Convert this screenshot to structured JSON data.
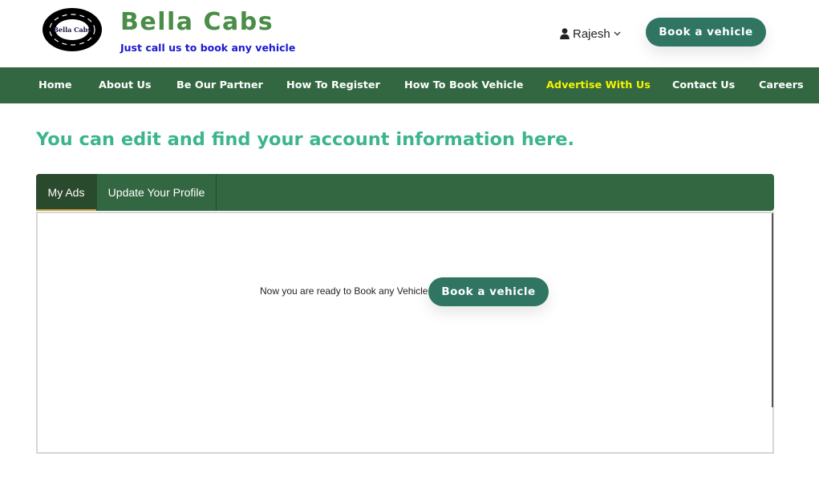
{
  "header": {
    "logo_text": "Bella Cabs",
    "brand_name": "Bella Cabs",
    "tagline": "Just call us to book any vehicle",
    "user_name": "Rajesh",
    "book_button": "Book a vehicle"
  },
  "nav": {
    "items": [
      {
        "label": "Home"
      },
      {
        "label": "About Us"
      },
      {
        "label": "Be Our Partner"
      },
      {
        "label": "How To Register"
      },
      {
        "label": "How To Book Vehicle"
      },
      {
        "label": "Advertise With Us"
      },
      {
        "label": "Contact Us"
      },
      {
        "label": "Careers"
      }
    ]
  },
  "main": {
    "heading": "You can edit and find your account information here.",
    "tabs": [
      {
        "label": "My Ads"
      },
      {
        "label": "Update Your Profile"
      }
    ],
    "panel": {
      "message": "Now you are ready to Book any Vehicle",
      "book_button": "Book a vehicle"
    }
  },
  "colors": {
    "brand_green": "#4a8d46",
    "nav_bg": "#326741",
    "heading_teal": "#3cb58f",
    "button_bg": "#2f7562",
    "nav_highlight": "#f4f400",
    "tagline_blue": "#1919d4"
  },
  "icons": {
    "logo": "tire-logo-icon",
    "user": "user-icon",
    "dropdown": "chevron-down-icon"
  }
}
